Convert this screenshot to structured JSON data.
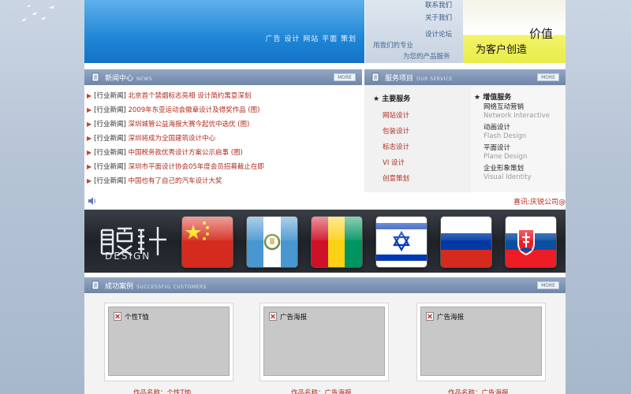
{
  "header": {
    "banner_tagline": "广告 设计 网站 平面 策划",
    "nav_links": [
      "联系我们",
      "关于我们",
      "设计论坛"
    ],
    "nav_slogan_lines": [
      "用我们的专业",
      "为您的产品服务"
    ],
    "promo_value": "价值",
    "promo_slogan": "为客户创造"
  },
  "news": {
    "title": "新闻中心",
    "subtitle": "NEWS",
    "more_label": "MORE",
    "items": [
      {
        "category": "[行业新闻]",
        "title": "北京首个禁烟标志亮相 设计简约寓意深刻"
      },
      {
        "category": "[行业新闻]",
        "title": "2009年东亚运动会徽章设计及得奖作品 (图)"
      },
      {
        "category": "[行业新闻]",
        "title": "深圳城管公益海报大赛今起优中选优 (图)"
      },
      {
        "category": "[行业新闻]",
        "title": "深圳将成为全国建筑设计中心"
      },
      {
        "category": "[行业新闻]",
        "title": "中国税务款优秀设计方案公示启事 (图)"
      },
      {
        "category": "[行业新闻]",
        "title": "深圳市平面设计协会05年度会员招募截止在即"
      },
      {
        "category": "[行业新闻]",
        "title": "中国也有了自己的汽车设计大奖"
      }
    ]
  },
  "services": {
    "title": "服务项目",
    "subtitle": "OUR SERVICE",
    "more_label": "MORE",
    "main_heading": "★ 主要服务",
    "main_items": [
      "网站设计",
      "包装设计",
      "标志设计",
      "VI 设计",
      "创意策划"
    ],
    "value_heading": "★ 增值服务",
    "value_items": [
      {
        "zh": "网络互动营销",
        "en": "Network Interactive"
      },
      {
        "zh": "动画设计",
        "en": "Flash Design"
      },
      {
        "zh": "平面设计",
        "en": "Plane Design"
      },
      {
        "zh": "企业形象策划",
        "en": "Visual Identity"
      }
    ]
  },
  "marquee": {
    "text": "喜讯:庆锐公司@"
  },
  "flags_strip": {
    "logo_text": "DESIGN",
    "flags": [
      "china-flag",
      "guatemala-flag",
      "guinea-flag",
      "israel-flag",
      "russia-flag",
      "slovakia-flag"
    ]
  },
  "cases": {
    "title": "成功案例",
    "subtitle": "SUCCESSFUL CUSTOMERS",
    "more_label": "MORE",
    "items": [
      {
        "label": "个性T恤",
        "caption": "作品名称：个性T恤"
      },
      {
        "label": "广告海报",
        "caption": "作品名称：广告海报"
      },
      {
        "label": "广告海报",
        "caption": "作品名称：广告海报"
      }
    ]
  },
  "colors": {
    "accent_red": "#b12a1d",
    "bar_blue": "#6f86a8",
    "banner_blue": "#1f86d6"
  }
}
